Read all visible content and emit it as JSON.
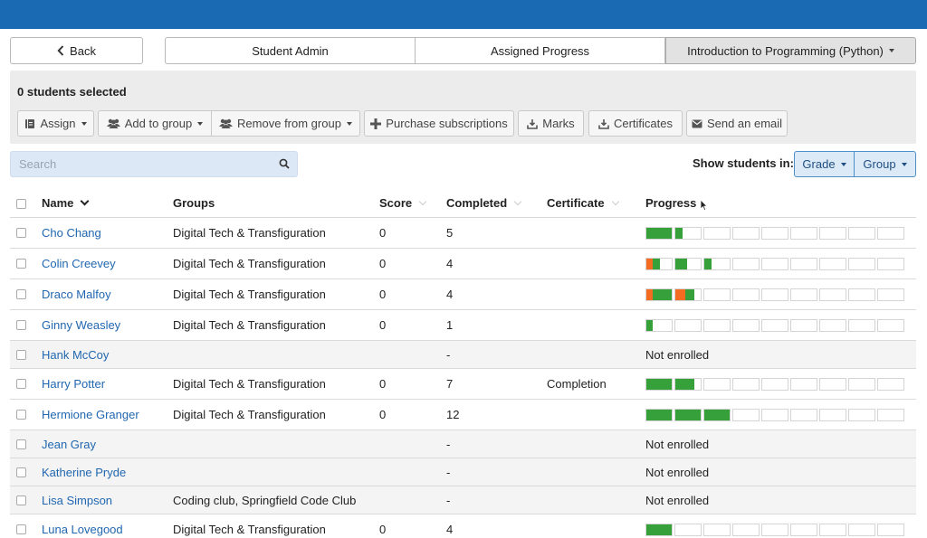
{
  "nav": {
    "back_label": "Back",
    "student_admin_label": "Student Admin",
    "assigned_progress_label": "Assigned Progress",
    "course_label": "Introduction to Programming (Python)"
  },
  "toolbar": {
    "selected_label": "0 students selected",
    "assign_label": "Assign",
    "add_group_label": "Add to group",
    "remove_group_label": "Remove from group",
    "purchase_label": "Purchase subscriptions",
    "marks_label": "Marks",
    "certificates_label": "Certificates",
    "email_label": "Send an email"
  },
  "search": {
    "placeholder": "Search"
  },
  "filter": {
    "label": "Show students in:",
    "grade_label": "Grade",
    "group_label": "Group"
  },
  "columns": {
    "name": "Name",
    "groups": "Groups",
    "score": "Score",
    "completed": "Completed",
    "certificate": "Certificate",
    "progress": "Progress"
  },
  "colors": {
    "green": "#36a13b",
    "orange": "#f36c21",
    "link": "#2167b0",
    "topbar": "#1a69b3"
  },
  "rows": [
    {
      "name": "Cho Chang",
      "groups": "Digital Tech & Transfiguration",
      "score": "0",
      "completed": "5",
      "certificate": "",
      "status": "",
      "progress": [
        [
          [
            "g",
            1.0
          ]
        ],
        [
          [
            "g",
            0.3
          ]
        ],
        [],
        [],
        [],
        [],
        [],
        [],
        []
      ]
    },
    {
      "name": "Colin Creevey",
      "groups": "Digital Tech & Transfiguration",
      "score": "0",
      "completed": "4",
      "certificate": "",
      "status": "",
      "progress": [
        [
          [
            "o",
            0.25
          ],
          [
            "g",
            0.3
          ]
        ],
        [
          [
            "g",
            0.45
          ]
        ],
        [
          [
            "g",
            0.3
          ]
        ],
        [],
        [],
        [],
        [],
        [],
        []
      ]
    },
    {
      "name": "Draco Malfoy",
      "groups": "Digital Tech & Transfiguration",
      "score": "0",
      "completed": "4",
      "certificate": "",
      "status": "",
      "progress": [
        [
          [
            "o",
            0.25
          ],
          [
            "g",
            0.75
          ]
        ],
        [
          [
            "o",
            0.4
          ],
          [
            "g",
            0.35
          ]
        ],
        [],
        [],
        [],
        [],
        [],
        [],
        []
      ]
    },
    {
      "name": "Ginny Weasley",
      "groups": "Digital Tech & Transfiguration",
      "score": "0",
      "completed": "1",
      "certificate": "",
      "status": "",
      "progress": [
        [
          [
            "g",
            0.25
          ]
        ],
        [],
        [],
        [],
        [],
        [],
        [],
        [],
        []
      ]
    },
    {
      "name": "Hank McCoy",
      "groups": "",
      "score": "",
      "completed": "-",
      "certificate": "",
      "status": "Not enrolled",
      "progress": []
    },
    {
      "name": "Harry Potter",
      "groups": "Digital Tech & Transfiguration",
      "score": "0",
      "completed": "7",
      "certificate": "Completion",
      "status": "",
      "progress": [
        [
          [
            "g",
            1.0
          ]
        ],
        [
          [
            "g",
            0.75
          ]
        ],
        [],
        [],
        [],
        [],
        [],
        [],
        []
      ]
    },
    {
      "name": "Hermione Granger",
      "groups": "Digital Tech & Transfiguration",
      "score": "0",
      "completed": "12",
      "certificate": "",
      "status": "",
      "progress": [
        [
          [
            "g",
            1.0
          ]
        ],
        [
          [
            "g",
            1.0
          ]
        ],
        [
          [
            "g",
            1.0
          ]
        ],
        [],
        [],
        [],
        [],
        [],
        []
      ]
    },
    {
      "name": "Jean Gray",
      "groups": "",
      "score": "",
      "completed": "-",
      "certificate": "",
      "status": "Not enrolled",
      "progress": []
    },
    {
      "name": "Katherine Pryde",
      "groups": "",
      "score": "",
      "completed": "-",
      "certificate": "",
      "status": "Not enrolled",
      "progress": []
    },
    {
      "name": "Lisa Simpson",
      "groups": "Coding club, Springfield Code Club",
      "score": "",
      "completed": "-",
      "certificate": "",
      "status": "Not enrolled",
      "progress": []
    },
    {
      "name": "Luna Lovegood",
      "groups": "Digital Tech & Transfiguration",
      "score": "0",
      "completed": "4",
      "certificate": "",
      "status": "",
      "progress": [
        [
          [
            "g",
            1.0
          ]
        ],
        [],
        [],
        [],
        [],
        [],
        [],
        [],
        []
      ]
    }
  ]
}
